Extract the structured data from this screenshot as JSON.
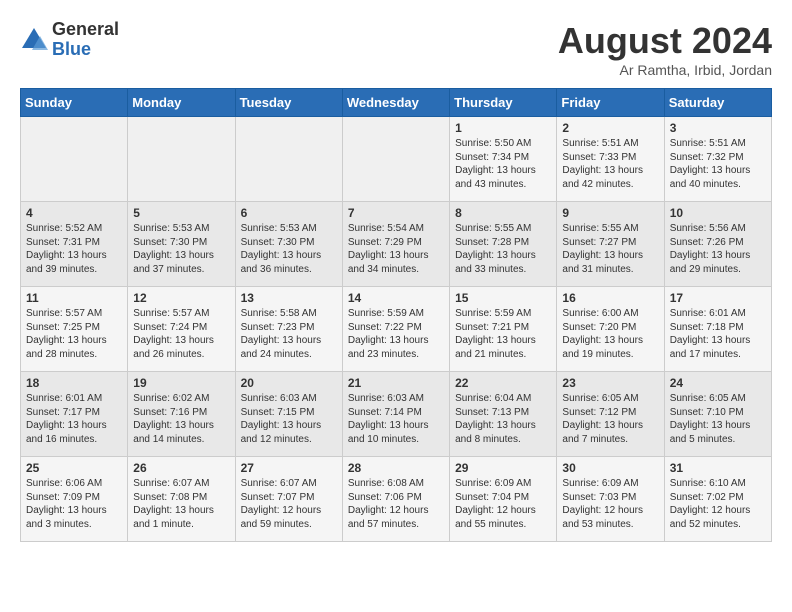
{
  "header": {
    "logo_general": "General",
    "logo_blue": "Blue",
    "month_year": "August 2024",
    "location": "Ar Ramtha, Irbid, Jordan"
  },
  "weekdays": [
    "Sunday",
    "Monday",
    "Tuesday",
    "Wednesday",
    "Thursday",
    "Friday",
    "Saturday"
  ],
  "weeks": [
    [
      {
        "day": "",
        "content": ""
      },
      {
        "day": "",
        "content": ""
      },
      {
        "day": "",
        "content": ""
      },
      {
        "day": "",
        "content": ""
      },
      {
        "day": "1",
        "content": "Sunrise: 5:50 AM\nSunset: 7:34 PM\nDaylight: 13 hours\nand 43 minutes."
      },
      {
        "day": "2",
        "content": "Sunrise: 5:51 AM\nSunset: 7:33 PM\nDaylight: 13 hours\nand 42 minutes."
      },
      {
        "day": "3",
        "content": "Sunrise: 5:51 AM\nSunset: 7:32 PM\nDaylight: 13 hours\nand 40 minutes."
      }
    ],
    [
      {
        "day": "4",
        "content": "Sunrise: 5:52 AM\nSunset: 7:31 PM\nDaylight: 13 hours\nand 39 minutes."
      },
      {
        "day": "5",
        "content": "Sunrise: 5:53 AM\nSunset: 7:30 PM\nDaylight: 13 hours\nand 37 minutes."
      },
      {
        "day": "6",
        "content": "Sunrise: 5:53 AM\nSunset: 7:30 PM\nDaylight: 13 hours\nand 36 minutes."
      },
      {
        "day": "7",
        "content": "Sunrise: 5:54 AM\nSunset: 7:29 PM\nDaylight: 13 hours\nand 34 minutes."
      },
      {
        "day": "8",
        "content": "Sunrise: 5:55 AM\nSunset: 7:28 PM\nDaylight: 13 hours\nand 33 minutes."
      },
      {
        "day": "9",
        "content": "Sunrise: 5:55 AM\nSunset: 7:27 PM\nDaylight: 13 hours\nand 31 minutes."
      },
      {
        "day": "10",
        "content": "Sunrise: 5:56 AM\nSunset: 7:26 PM\nDaylight: 13 hours\nand 29 minutes."
      }
    ],
    [
      {
        "day": "11",
        "content": "Sunrise: 5:57 AM\nSunset: 7:25 PM\nDaylight: 13 hours\nand 28 minutes."
      },
      {
        "day": "12",
        "content": "Sunrise: 5:57 AM\nSunset: 7:24 PM\nDaylight: 13 hours\nand 26 minutes."
      },
      {
        "day": "13",
        "content": "Sunrise: 5:58 AM\nSunset: 7:23 PM\nDaylight: 13 hours\nand 24 minutes."
      },
      {
        "day": "14",
        "content": "Sunrise: 5:59 AM\nSunset: 7:22 PM\nDaylight: 13 hours\nand 23 minutes."
      },
      {
        "day": "15",
        "content": "Sunrise: 5:59 AM\nSunset: 7:21 PM\nDaylight: 13 hours\nand 21 minutes."
      },
      {
        "day": "16",
        "content": "Sunrise: 6:00 AM\nSunset: 7:20 PM\nDaylight: 13 hours\nand 19 minutes."
      },
      {
        "day": "17",
        "content": "Sunrise: 6:01 AM\nSunset: 7:18 PM\nDaylight: 13 hours\nand 17 minutes."
      }
    ],
    [
      {
        "day": "18",
        "content": "Sunrise: 6:01 AM\nSunset: 7:17 PM\nDaylight: 13 hours\nand 16 minutes."
      },
      {
        "day": "19",
        "content": "Sunrise: 6:02 AM\nSunset: 7:16 PM\nDaylight: 13 hours\nand 14 minutes."
      },
      {
        "day": "20",
        "content": "Sunrise: 6:03 AM\nSunset: 7:15 PM\nDaylight: 13 hours\nand 12 minutes."
      },
      {
        "day": "21",
        "content": "Sunrise: 6:03 AM\nSunset: 7:14 PM\nDaylight: 13 hours\nand 10 minutes."
      },
      {
        "day": "22",
        "content": "Sunrise: 6:04 AM\nSunset: 7:13 PM\nDaylight: 13 hours\nand 8 minutes."
      },
      {
        "day": "23",
        "content": "Sunrise: 6:05 AM\nSunset: 7:12 PM\nDaylight: 13 hours\nand 7 minutes."
      },
      {
        "day": "24",
        "content": "Sunrise: 6:05 AM\nSunset: 7:10 PM\nDaylight: 13 hours\nand 5 minutes."
      }
    ],
    [
      {
        "day": "25",
        "content": "Sunrise: 6:06 AM\nSunset: 7:09 PM\nDaylight: 13 hours\nand 3 minutes."
      },
      {
        "day": "26",
        "content": "Sunrise: 6:07 AM\nSunset: 7:08 PM\nDaylight: 13 hours\nand 1 minute."
      },
      {
        "day": "27",
        "content": "Sunrise: 6:07 AM\nSunset: 7:07 PM\nDaylight: 12 hours\nand 59 minutes."
      },
      {
        "day": "28",
        "content": "Sunrise: 6:08 AM\nSunset: 7:06 PM\nDaylight: 12 hours\nand 57 minutes."
      },
      {
        "day": "29",
        "content": "Sunrise: 6:09 AM\nSunset: 7:04 PM\nDaylight: 12 hours\nand 55 minutes."
      },
      {
        "day": "30",
        "content": "Sunrise: 6:09 AM\nSunset: 7:03 PM\nDaylight: 12 hours\nand 53 minutes."
      },
      {
        "day": "31",
        "content": "Sunrise: 6:10 AM\nSunset: 7:02 PM\nDaylight: 12 hours\nand 52 minutes."
      }
    ]
  ]
}
